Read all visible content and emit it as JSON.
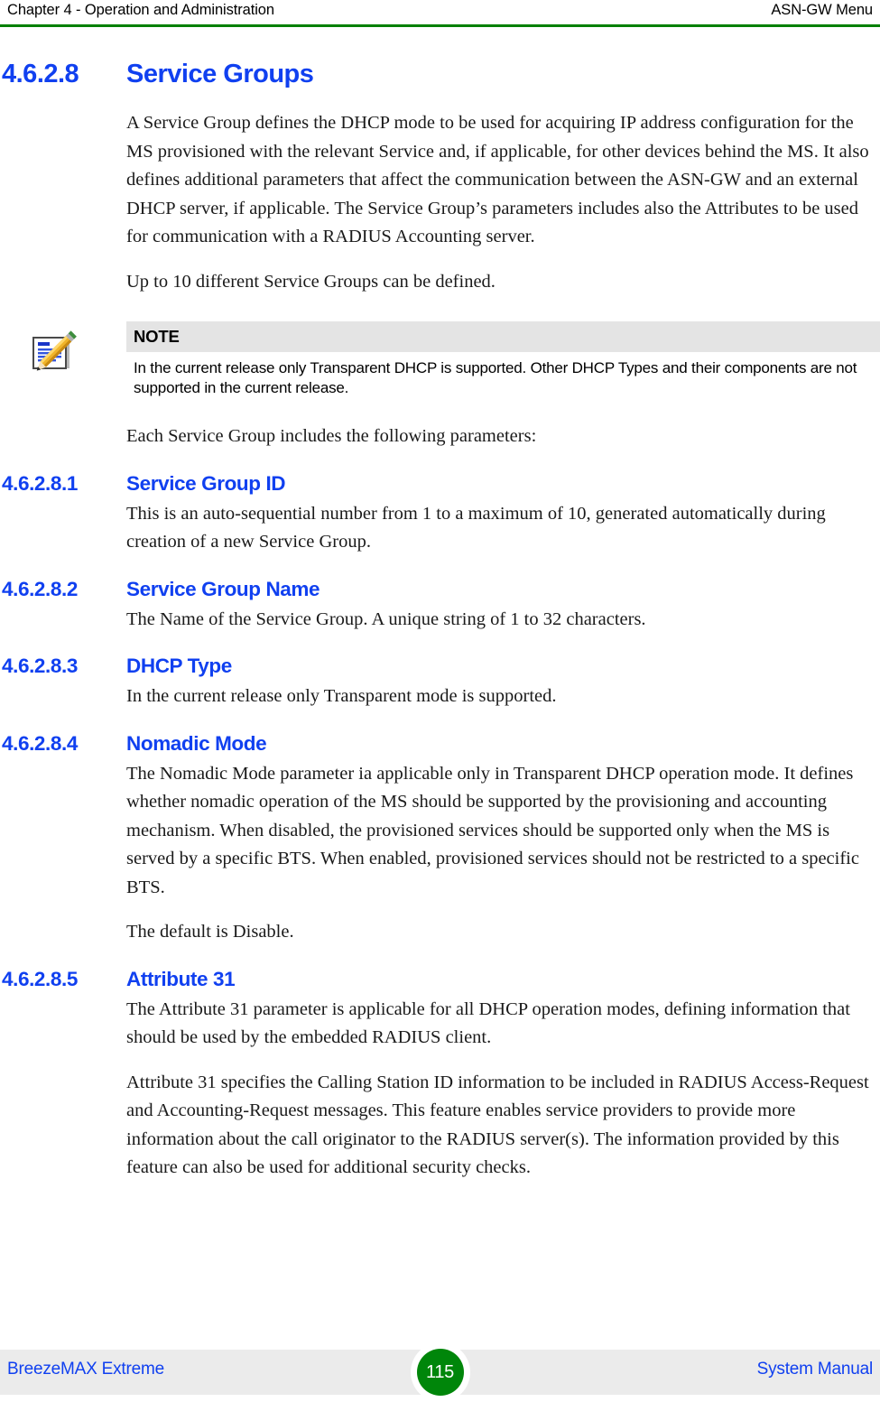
{
  "header": {
    "left": "Chapter 4 - Operation and Administration",
    "right": "ASN-GW Menu",
    "rule_color": "#008000"
  },
  "section": {
    "number": "4.6.2.8",
    "title": "Service Groups",
    "heading_color": "#1040f0",
    "paragraphs": [
      "A Service Group defines the DHCP mode to be used for acquiring IP address configuration for the MS provisioned with the relevant Service and, if applicable, for other devices behind the MS. It also defines additional parameters that affect the communication between the ASN-GW and an external DHCP server, if applicable. The Service Group’s parameters includes also the Attributes to be used for communication with a RADIUS Accounting server.",
      "Up to 10 different Service Groups can be defined."
    ],
    "after_note_paragraph": "Each Service Group includes the following parameters:"
  },
  "note": {
    "icon": "note-pencil-icon",
    "title": "NOTE",
    "text": "In the current release only Transparent DHCP is supported. Other DHCP Types and their components are not supported in the current release.",
    "bar_color": "#e4e4e4"
  },
  "subsections": [
    {
      "number": "4.6.2.8.1",
      "title": "Service Group ID",
      "paragraphs": [
        "This is an auto-sequential number from 1 to a maximum of 10, generated automatically during creation of a new Service Group."
      ]
    },
    {
      "number": "4.6.2.8.2",
      "title": "Service Group Name",
      "paragraphs": [
        "The Name of the Service Group. A unique string of 1 to 32 characters."
      ]
    },
    {
      "number": "4.6.2.8.3",
      "title": "DHCP Type",
      "paragraphs": [
        "In the current release only Transparent mode is supported."
      ]
    },
    {
      "number": "4.6.2.8.4",
      "title": "Nomadic Mode",
      "paragraphs": [
        "The Nomadic Mode parameter ia applicable only in Transparent DHCP operation mode. It defines whether nomadic operation of the MS should be supported by the provisioning and accounting mechanism. When disabled, the provisioned services should be supported only when the MS is served by a specific BTS. When enabled, provisioned services should not be restricted to a specific BTS.",
        "The default is Disable."
      ]
    },
    {
      "number": "4.6.2.8.5",
      "title": "Attribute 31",
      "paragraphs": [
        "The Attribute 31 parameter is applicable for all DHCP operation modes, defining information that should be used by the embedded RADIUS client.",
        "Attribute 31 specifies the Calling Station ID information to be included in RADIUS Access-Request and Accounting-Request messages. This feature enables service providers to provide more information about the call originator to the RADIUS server(s). The information provided by this feature can also be used for additional security checks."
      ]
    }
  ],
  "footer": {
    "left": "BreezeMAX Extreme",
    "page_number": "115",
    "right": "System Manual",
    "badge_color": "#00860a",
    "band_color": "#ebebeb",
    "text_color": "#1040f0"
  }
}
